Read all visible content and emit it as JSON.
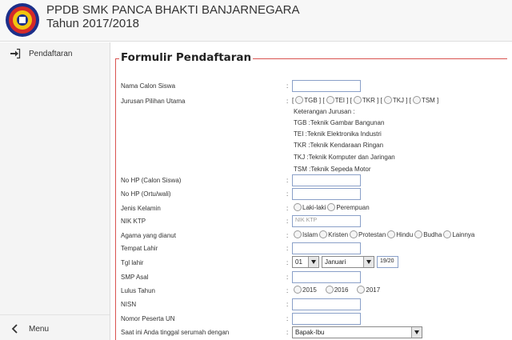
{
  "header": {
    "title_line1": "PPDB SMK PANCA BHAKTI BANJARNEGARA",
    "title_line2": "Tahun 2017/2018",
    "logo_icon": "school-emblem-icon"
  },
  "sidebar": {
    "items": [
      {
        "label": "Pendaftaran",
        "icon": "sign-in-icon"
      },
      {
        "label": "Menu",
        "icon": "chevron-left-icon"
      }
    ]
  },
  "form": {
    "legend": "Formulir Pendaftaran",
    "colon": ":",
    "nama": {
      "label": "Nama Calon Siswa",
      "value": ""
    },
    "jurusan": {
      "label": "Jurusan Pilihan Utama",
      "options": [
        "TGB",
        "TEI",
        "TKR",
        "TKJ",
        "TSM"
      ],
      "note_title": "Keterangan Jurusan :",
      "notes": [
        "TGB :Teknik Gambar Bangunan",
        "TEI :Teknik Elektronika Industri",
        "TKR :Teknik Kendaraan Ringan",
        "TKJ :Teknik Komputer dan Jaringan",
        "TSM :Teknik Sepeda Motor"
      ]
    },
    "hp_siswa": {
      "label": "No HP (Calon Siswa)",
      "value": ""
    },
    "hp_ortu": {
      "label": "No HP (Ortu/wali)",
      "value": ""
    },
    "jenis_kelamin": {
      "label": "Jenis Kelamin",
      "options": [
        "Laki-laki",
        "Perempuan"
      ]
    },
    "nik": {
      "label": "NIK KTP",
      "placeholder": "NIK KTP"
    },
    "agama": {
      "label": "Agama yang dianut",
      "options": [
        "Islam",
        "Kristen",
        "Protestan",
        "Hindu",
        "Budha",
        "Lainnya"
      ]
    },
    "tempat_lahir": {
      "label": "Tempat Lahir",
      "value": ""
    },
    "tgl_lahir": {
      "label": "Tgl lahir",
      "day": "01",
      "month": "Januari",
      "year": "19/20"
    },
    "smp_asal": {
      "label": "SMP Asal",
      "value": ""
    },
    "lulus_tahun": {
      "label": "Lulus Tahun",
      "options": [
        "2015",
        "2016",
        "2017"
      ]
    },
    "nisn": {
      "label": "NISN",
      "value": ""
    },
    "nomor_un": {
      "label": "Nomor Peserta UN",
      "value": ""
    },
    "tinggal": {
      "label": "Saat ini Anda tinggal serumah dengan",
      "selected": "Bapak-Ibu"
    }
  }
}
